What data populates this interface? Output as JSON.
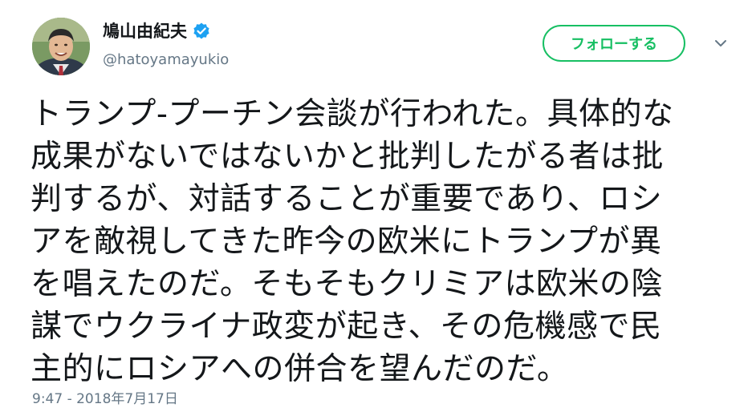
{
  "author": {
    "display_name": "鳩山由紀夫",
    "handle": "@hatoyamayukio",
    "verified": true
  },
  "follow_button": {
    "label": "フォローする"
  },
  "icons": {
    "verified": "verified-badge-icon",
    "caret": "chevron-down-icon"
  },
  "tweet": {
    "lines": [
      "トランプ-プーチン会談が行われた。具体的な",
      "成果がないではないかと批判したがる者は批",
      "判するが、対話することが重要であり、ロシ",
      "アを敵視してきた昨今の欧米にトランプが異",
      "を唱えたのだ。そもそもクリミアは欧米の陰",
      "謀でウクライナ政変が起き、その危機感で民",
      "主的にロシアへの併合を望んだのだ。"
    ],
    "timestamp": "9:47 - 2018年7月17日"
  },
  "colors": {
    "follow_green": "#17bf63",
    "verified_blue": "#1da1f2",
    "text": "#14171a",
    "muted": "#657786"
  }
}
